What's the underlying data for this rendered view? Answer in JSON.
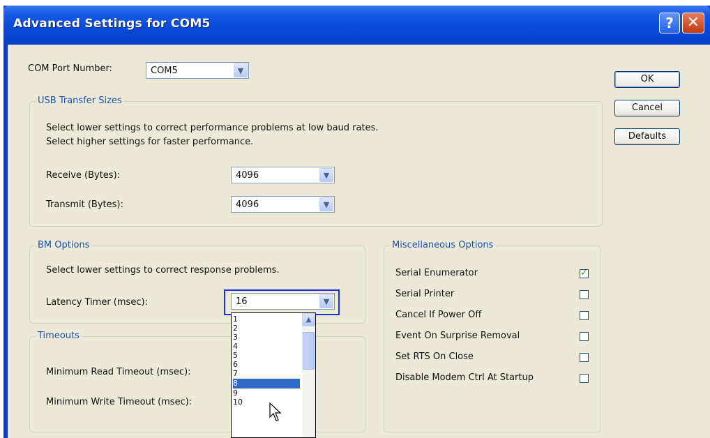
{
  "window": {
    "title": "Advanced Settings for COM5",
    "help_label": "?",
    "close_label": "✕"
  },
  "com_port": {
    "label": "COM Port Number:",
    "value": "COM5"
  },
  "usb": {
    "title": "USB Transfer Sizes",
    "desc1": "Select lower settings to correct performance problems at low baud rates.",
    "desc2": "Select higher settings for faster performance.",
    "receive_label": "Receive (Bytes):",
    "receive_value": "4096",
    "transmit_label": "Transmit (Bytes):",
    "transmit_value": "4096"
  },
  "bm": {
    "title": "BM Options",
    "desc": "Select lower settings to correct response problems.",
    "latency_label": "Latency Timer (msec):",
    "latency_value": "16"
  },
  "timeouts": {
    "title": "Timeouts",
    "read_label": "Minimum Read Timeout (msec):",
    "write_label": "Minimum Write Timeout (msec):"
  },
  "misc": {
    "title": "Miscellaneous Options",
    "options": [
      {
        "label": "Serial Enumerator",
        "checked": true
      },
      {
        "label": "Serial Printer",
        "checked": false
      },
      {
        "label": "Cancel If Power Off",
        "checked": false
      },
      {
        "label": "Event On Surprise Removal",
        "checked": false
      },
      {
        "label": "Set RTS On Close",
        "checked": false
      },
      {
        "label": "Disable Modem Ctrl At Startup",
        "checked": false
      }
    ]
  },
  "buttons": {
    "ok": "OK",
    "cancel": "Cancel",
    "defaults": "Defaults"
  },
  "latency_dropdown": {
    "items": [
      "1",
      "2",
      "3",
      "4",
      "5",
      "6",
      "7",
      "8",
      "9",
      "10"
    ],
    "selected": "8"
  },
  "icons": {
    "arrow": "chevron-down-icon",
    "check": "checkmark-icon",
    "cursor": "mouse-pointer-icon"
  },
  "colors": {
    "titlebar": "#0a48d8",
    "dialog_bg": "#ece9d8",
    "group_title": "#1f4fb0",
    "selection": "#316ac5",
    "highlight_box": "#1a2ee0"
  }
}
